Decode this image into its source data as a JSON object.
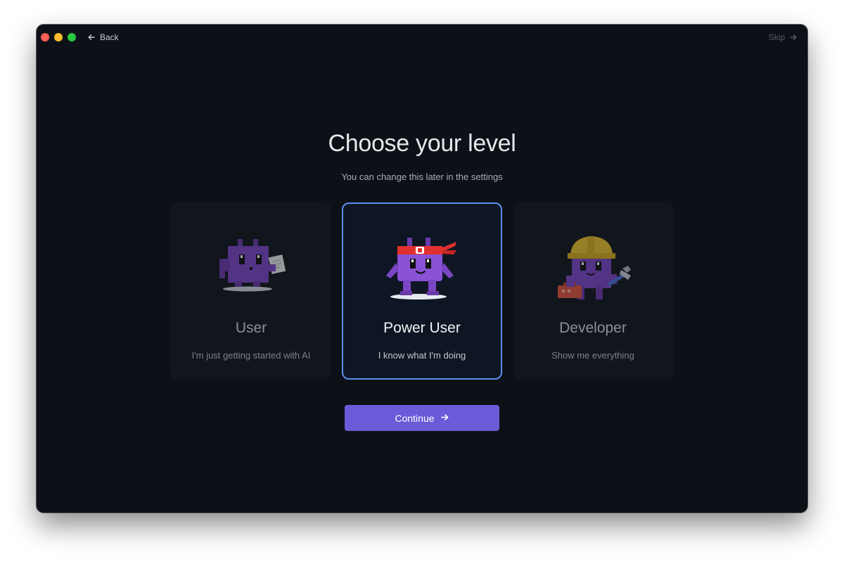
{
  "nav": {
    "back_label": "Back",
    "skip_label": "Skip"
  },
  "heading": {
    "title": "Choose your level",
    "subtitle": "You can change this later in the settings"
  },
  "levels": [
    {
      "title": "User",
      "description": "I'm just getting started with AI",
      "selected": false,
      "mascot": "purple-robot-with-paper"
    },
    {
      "title": "Power User",
      "description": "I know what I'm doing",
      "selected": true,
      "mascot": "purple-robot-with-headband"
    },
    {
      "title": "Developer",
      "description": "Show me everything",
      "selected": false,
      "mascot": "purple-robot-with-hardhat-and-hammer"
    }
  ],
  "actions": {
    "continue_label": "Continue"
  },
  "colors": {
    "window_bg": "#0d1117",
    "selected_border": "#5b8ff0",
    "primary_button": "#6a5bd8",
    "mascot_purple": "#7a46c4"
  }
}
